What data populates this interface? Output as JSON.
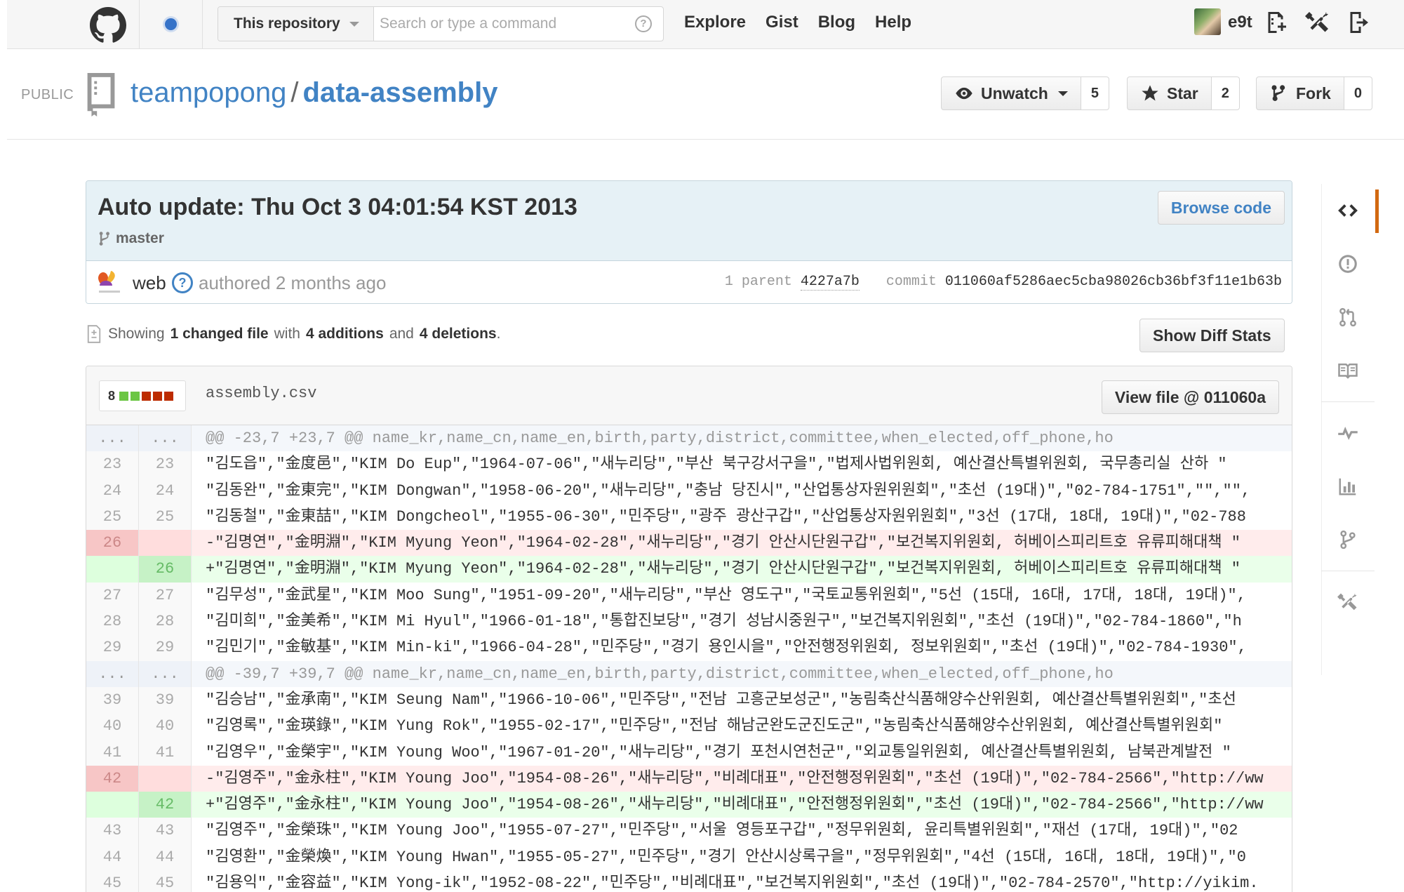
{
  "header": {
    "search_scope": "This repository",
    "search_placeholder": "Search or type a command",
    "nav": [
      "Explore",
      "Gist",
      "Blog",
      "Help"
    ],
    "username": "e9t"
  },
  "repo": {
    "visibility": "PUBLIC",
    "owner": "teampopong",
    "name": "data-assembly",
    "unwatch_label": "Unwatch",
    "watch_count": "5",
    "star_label": "Star",
    "star_count": "2",
    "fork_label": "Fork",
    "fork_count": "0"
  },
  "commit": {
    "title": "Auto update: Thu Oct 3 04:01:54 KST 2013",
    "branch": "master",
    "browse_label": "Browse code",
    "author": "web",
    "authored_text": "authored 2 months ago",
    "parent_label": "1 parent",
    "parent_sha": "4227a7b",
    "commit_label": "commit",
    "commit_sha": "011060af5286aec5cba98026cb36bf3f11e1b63b"
  },
  "summary": {
    "showing": "Showing",
    "changed": "1 changed file",
    "with": "with",
    "additions": "4 additions",
    "and": "and",
    "deletions": "4 deletions",
    "period": ".",
    "diff_stats_label": "Show Diff Stats"
  },
  "file": {
    "changes": "8",
    "name": "assembly.csv",
    "view_label": "View file @ 011060a"
  },
  "diff_lines": [
    {
      "type": "hunk",
      "old": "...",
      "new": "...",
      "code": "@@ -23,7 +23,7 @@ name_kr,name_cn,name_en,birth,party,district,committee,when_elected,off_phone,ho"
    },
    {
      "type": "ctx",
      "old": "23",
      "new": "23",
      "code": " \"김도읍\",\"金度邑\",\"KIM Do Eup\",\"1964-07-06\",\"새누리당\",\"부산 북구강서구을\",\"법제사법위원회, 예산결산특별위원회, 국무총리실 산하 \""
    },
    {
      "type": "ctx",
      "old": "24",
      "new": "24",
      "code": " \"김동완\",\"金東完\",\"KIM Dongwan\",\"1958-06-20\",\"새누리당\",\"충남 당진시\",\"산업통상자원위원회\",\"초선 (19대)\",\"02-784-1751\",\"\",\"\","
    },
    {
      "type": "ctx",
      "old": "25",
      "new": "25",
      "code": " \"김동철\",\"金東喆\",\"KIM Dongcheol\",\"1955-06-30\",\"민주당\",\"광주 광산구갑\",\"산업통상자원위원회\",\"3선 (17대, 18대, 19대)\",\"02-788"
    },
    {
      "type": "del",
      "old": "26",
      "new": "",
      "code": "-\"김명연\",\"金明淵\",\"KIM Myung Yeon\",\"1964-02-28\",\"새누리당\",\"경기 안산시단원구갑\",\"보건복지위원회, 허베이스피리트호 유류피해대책 \""
    },
    {
      "type": "add",
      "old": "",
      "new": "26",
      "code": "+\"김명연\",\"金明淵\",\"KIM Myung Yeon\",\"1964-02-28\",\"새누리당\",\"경기 안산시단원구갑\",\"보건복지위원회, 허베이스피리트호 유류피해대책 \""
    },
    {
      "type": "ctx",
      "old": "27",
      "new": "27",
      "code": " \"김무성\",\"金武星\",\"KIM Moo Sung\",\"1951-09-20\",\"새누리당\",\"부산 영도구\",\"국토교통위원회\",\"5선 (15대, 16대, 17대, 18대, 19대)\","
    },
    {
      "type": "ctx",
      "old": "28",
      "new": "28",
      "code": " \"김미희\",\"金美希\",\"KIM Mi Hyul\",\"1966-01-18\",\"통합진보당\",\"경기 성남시중원구\",\"보건복지위원회\",\"초선 (19대)\",\"02-784-1860\",\"h"
    },
    {
      "type": "ctx",
      "old": "29",
      "new": "29",
      "code": " \"김민기\",\"金敏基\",\"KIM Min-ki\",\"1966-04-28\",\"민주당\",\"경기 용인시을\",\"안전행정위원회, 정보위원회\",\"초선 (19대)\",\"02-784-1930\","
    },
    {
      "type": "hunk",
      "old": "...",
      "new": "...",
      "code": "@@ -39,7 +39,7 @@ name_kr,name_cn,name_en,birth,party,district,committee,when_elected,off_phone,ho"
    },
    {
      "type": "ctx",
      "old": "39",
      "new": "39",
      "code": " \"김승남\",\"金承南\",\"KIM Seung Nam\",\"1966-10-06\",\"민주당\",\"전남 고흥군보성군\",\"농림축산식품해양수산위원회, 예산결산특별위원회\",\"초선"
    },
    {
      "type": "ctx",
      "old": "40",
      "new": "40",
      "code": " \"김영록\",\"金瑛錄\",\"KIM Yung Rok\",\"1955-02-17\",\"민주당\",\"전남 해남군완도군진도군\",\"농림축산식품해양수산위원회, 예산결산특별위원회\""
    },
    {
      "type": "ctx",
      "old": "41",
      "new": "41",
      "code": " \"김영우\",\"金榮宇\",\"KIM Young Woo\",\"1967-01-20\",\"새누리당\",\"경기 포천시연천군\",\"외교통일위원회, 예산결산특별위원회, 남북관계발전 \""
    },
    {
      "type": "del",
      "old": "42",
      "new": "",
      "code": "-\"김영주\",\"金永柱\",\"KIM Young Joo\",\"1954-08-26\",\"새누리당\",\"비례대표\",\"안전행정위원회\",\"초선 (19대)\",\"02-784-2566\",\"http://ww"
    },
    {
      "type": "add",
      "old": "",
      "new": "42",
      "code": "+\"김영주\",\"金永柱\",\"KIM Young Joo\",\"1954-08-26\",\"새누리당\",\"비례대표\",\"안전행정위원회\",\"초선 (19대)\",\"02-784-2566\",\"http://ww"
    },
    {
      "type": "ctx",
      "old": "43",
      "new": "43",
      "code": " \"김영주\",\"金榮珠\",\"KIM Young Joo\",\"1955-07-27\",\"민주당\",\"서울 영등포구갑\",\"정무위원회, 윤리특별위원회\",\"재선 (17대, 19대)\",\"02"
    },
    {
      "type": "ctx",
      "old": "44",
      "new": "44",
      "code": " \"김영환\",\"金榮煥\",\"KIM Young Hwan\",\"1955-05-27\",\"민주당\",\"경기 안산시상록구을\",\"정무위원회\",\"4선 (15대, 16대, 18대, 19대)\",\"0"
    },
    {
      "type": "ctx",
      "old": "45",
      "new": "45",
      "code": " \"김용익\",\"金容益\",\"KIM Yong-ik\",\"1952-08-22\",\"민주당\",\"비례대표\",\"보건복지위원회\",\"초선 (19대)\",\"02-784-2570\",\"http://yikim."
    }
  ],
  "icons": {
    "logo": "github-octocat-icon",
    "notifications": "notification-dot-icon",
    "help": "help-icon",
    "new_repo": "new-repo-icon",
    "settings": "tools-icon",
    "sign_out": "sign-out-icon"
  },
  "colors": {
    "link": "#4183c4",
    "deletion": "#ffecec",
    "addition": "#eaffea",
    "active_tab": "#d26911"
  }
}
